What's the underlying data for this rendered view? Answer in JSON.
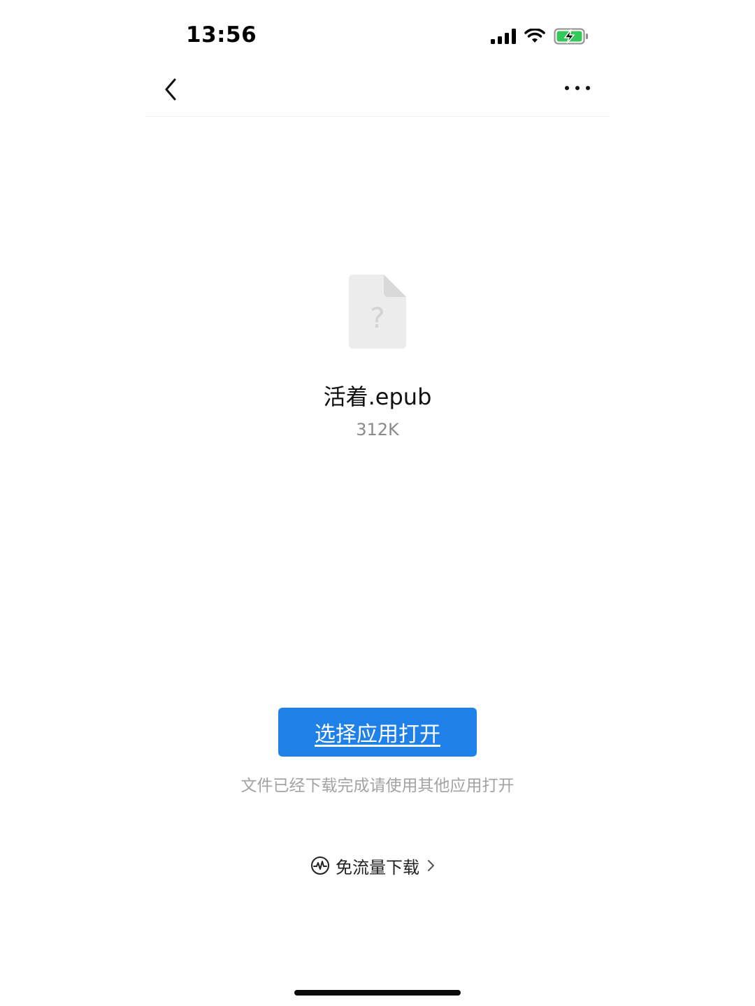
{
  "status_bar": {
    "time": "13:56",
    "icons": [
      "cellular-signal-icon",
      "wifi-icon",
      "battery-charging-icon"
    ],
    "battery_color": "#34c759"
  },
  "nav": {
    "icons": [
      "chevron-left-icon",
      "more-dots-icon"
    ]
  },
  "file": {
    "icon": "unknown-file-icon",
    "icon_glyph": "?",
    "name": "活着.epub",
    "size": "312K"
  },
  "actions": {
    "open_with_label": "选择应用打开",
    "hint": "文件已经下载完成请使用其他应用打开",
    "free_download_label": "免流量下载",
    "free_download_icon": "pulse-circle-icon"
  },
  "colors": {
    "accent": "#1f80e8",
    "muted_text": "#a3a3a3"
  }
}
